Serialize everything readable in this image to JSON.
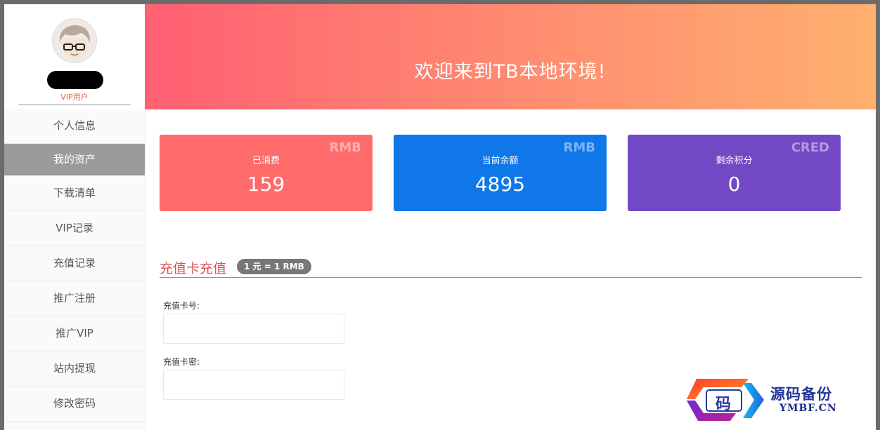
{
  "sidebar": {
    "user_role": "VIP用户",
    "items": [
      {
        "label": "个人信息",
        "active": false
      },
      {
        "label": "我的资产",
        "active": true
      },
      {
        "label": "下载清单",
        "active": false
      },
      {
        "label": "VIP记录",
        "active": false
      },
      {
        "label": "充值记录",
        "active": false
      },
      {
        "label": "推广注册",
        "active": false
      },
      {
        "label": "推广VIP",
        "active": false
      },
      {
        "label": "站内提现",
        "active": false
      },
      {
        "label": "修改密码",
        "active": false
      }
    ]
  },
  "banner": {
    "title": "欢迎来到TB本地环境!"
  },
  "stats": [
    {
      "label": "已消费",
      "value": "159",
      "unit": "RMB",
      "color": "#ff6b6b"
    },
    {
      "label": "当前余额",
      "value": "4895",
      "unit": "RMB",
      "color": "#0f77e8"
    },
    {
      "label": "剩余积分",
      "value": "0",
      "unit": "CRED",
      "color": "#7348c4"
    }
  ],
  "recharge": {
    "title": "充值卡充值",
    "rate_badge": "1 元 = 1 RMB",
    "card_number_label": "充值卡号:",
    "card_number_value": "",
    "card_password_label": "充值卡密:",
    "card_password_value": ""
  },
  "watermark": {
    "logo_char": "码",
    "text_cn": "源码备份",
    "text_en": "YMBF.CN"
  },
  "colors": {
    "banner_gradient_start": "#ff5f72",
    "banner_gradient_end": "#ffb06f",
    "nav_active": "#9b9b9b",
    "section_title": "#d9534f"
  }
}
